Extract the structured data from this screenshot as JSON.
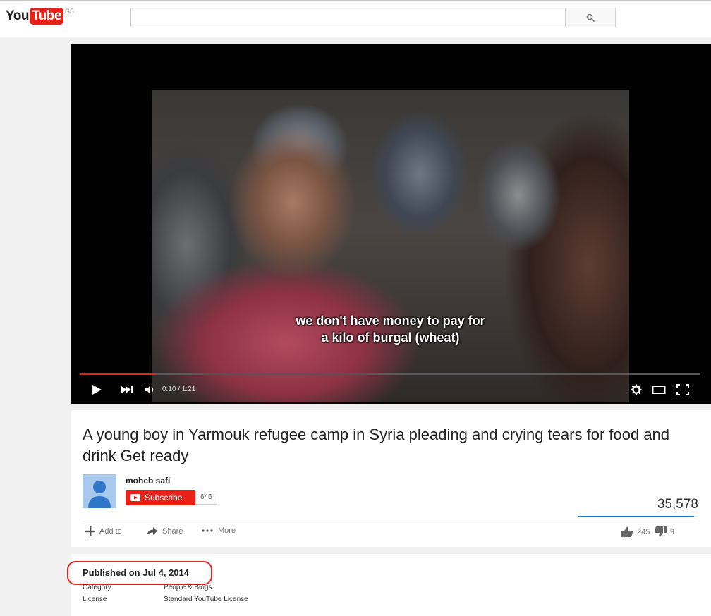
{
  "header": {
    "logo_you": "You",
    "logo_tube": "Tube",
    "logo_region": "GB",
    "search_placeholder": "",
    "search_icon": "search-icon"
  },
  "player": {
    "subtitle_line1": "we don't have money to pay for",
    "subtitle_line2": "a kilo of burgal (wheat)",
    "current_time": "0:10",
    "duration": "1:21",
    "time_display": "0:10 / 1:21",
    "progress_fraction": 0.123,
    "icons": [
      "play-icon",
      "next-icon",
      "volume-icon",
      "settings-icon",
      "theater-mode-icon",
      "fullscreen-icon"
    ],
    "colors": {
      "progress": "#e62117"
    }
  },
  "video": {
    "title": "A young boy in Yarmouk refugee camp in Syria pleading and crying tears for food and drink Get ready",
    "channel_name": "moheb safi",
    "subscribe_label": "Subscribe",
    "subscriber_count": "646",
    "view_count": "35,578",
    "like_ratio": 0.964,
    "actions": {
      "add_to": "Add to",
      "share": "Share",
      "more": "More"
    },
    "likes": "245",
    "dislikes": "9"
  },
  "description": {
    "published": "Published on Jul 4, 2014",
    "category_label": "Category",
    "category_value": "People & Blogs",
    "license_label": "License",
    "license_value": "Standard YouTube License"
  },
  "colors": {
    "brand_red": "#e62117",
    "accent_blue": "#167ac6",
    "annotation_red": "#e02424"
  }
}
